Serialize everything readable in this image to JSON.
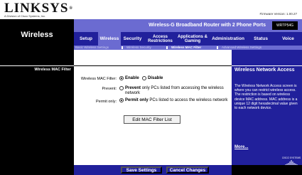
{
  "brand": {
    "logo_text": "LINKSYS",
    "logo_mark": "®",
    "subtitle": "A Division of Cisco Systems, Inc.",
    "firmware": "Firmware Version: 1.00.27"
  },
  "header": {
    "section_title": "Wireless",
    "product_name": "Wireless-G Broadband Router with 2 Phone Ports",
    "model": "WRTP54G"
  },
  "tabs": [
    {
      "label": "Setup"
    },
    {
      "label": "Wireless"
    },
    {
      "label": "Security"
    },
    {
      "label": "Access Restrictions"
    },
    {
      "label": "Applications & Gaming"
    },
    {
      "label": "Administration"
    },
    {
      "label": "Status"
    },
    {
      "label": "Voice"
    }
  ],
  "subtabs": [
    {
      "label": "Basic Wireless Settings"
    },
    {
      "label": "Wireless Security"
    },
    {
      "label": "Wireless MAC Filter"
    },
    {
      "label": "Advanced Wireless Settings"
    }
  ],
  "left": {
    "section_label": "Wireless MAC Filter"
  },
  "form": {
    "mac_filter_label": "Wireless MAC Filter:",
    "enable_label": "Enable",
    "disable_label": "Disable",
    "prevent_label": "Prevent:",
    "prevent_bold": "Prevent",
    "prevent_text": "only PCs listed from accessing the wireless network",
    "permit_label": "Permit only:",
    "permit_bold": "Permit only",
    "permit_text": "PCs listed to access the wireless network",
    "edit_button": "Edit MAC Filter List"
  },
  "help": {
    "title": "Wireless Network Access",
    "body": "The Wireless Network Access screen is where you can restrict wireless access. The restriction is based on wireless device MAC address. MAC address is a unique 12 digit hexadecimal value given to each network device.",
    "more": "More...",
    "cisco_text": "CISCO SYSTEMS"
  },
  "footer": {
    "save": "Save Settings",
    "cancel": "Cancel Changes"
  }
}
